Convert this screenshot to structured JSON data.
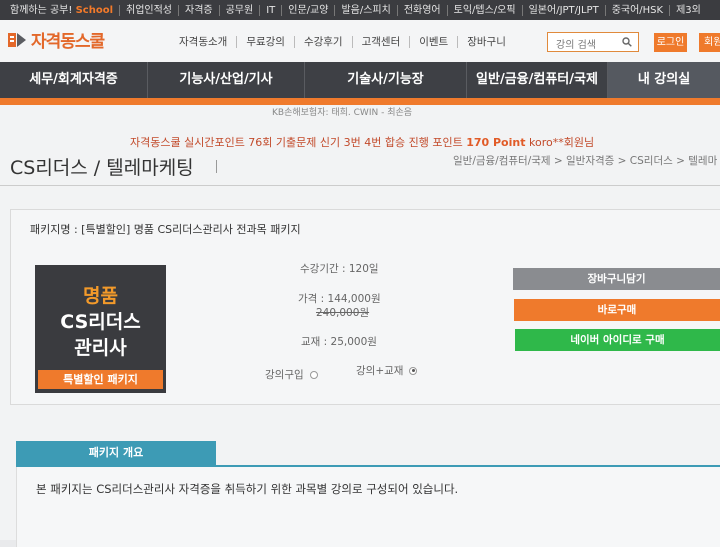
{
  "topbar": {
    "items": [
      "함께하는 공부!",
      "취업인적성",
      "자격증",
      "공무원",
      "IT",
      "인문/교양",
      "발음/스피치",
      "전화영어",
      "토익/텝스/오픽",
      "일본어/JPT/JLPT",
      "중국어/HSK",
      "제3외"
    ],
    "brand": "School"
  },
  "header": {
    "logo_text": "자격동스쿨",
    "nav": [
      "자격동소개",
      "무료강의",
      "수강후기",
      "고객센터",
      "이벤트",
      "장바구니"
    ],
    "search_placeholder": "강의 검색",
    "login_label": "로그인",
    "join_label": "회원"
  },
  "mainnav": {
    "items": [
      "세무/회계자격증",
      "기능사/산업/기사",
      "기술사/기능장",
      "일반/금융/컴퓨터/국제",
      "내 강의실"
    ]
  },
  "notice": {
    "line1": "KB손해보험자: 태희. CWIN - 최손음",
    "line2_prefix": "자격동스쿨 실시간포인트 76회 기출문제 신기 3번 4번 합승 진행 포인트 ",
    "line2_points": "170 Point",
    "line2_suffix": " koro**회원님"
  },
  "page": {
    "title": "CS리더스 / 텔레마케팅",
    "breadcrumb": "일반/금융/컴퓨터/국제 > 일반자격증 > CS리더스 > 텔레마"
  },
  "package": {
    "name": "패키지명 : [특별할인] 명품 CS리더스관리사 전과목 패키지",
    "book_line1": "명품",
    "book_line2": "CS리더스",
    "book_line3": "관리사",
    "book_ribbon": "특별할인 패키지",
    "period": "수강기간 : 120일",
    "price": "가격 : 144,000원",
    "original_price": "240,000원",
    "textbook": "교재 : 25,000원",
    "option_lecture": "강의구입",
    "option_lecture_textbook": "강의+교재",
    "selected_option": "강의+교재"
  },
  "buttons": {
    "cart": "장바구니담기",
    "buy": "바로구매",
    "naver": "네이버 아이디로 구매"
  },
  "overview": {
    "tab": "패키지 개요",
    "text": "본 패키지는 CS리더스관리사 자격증을 취득하기 위한 과목별 강의로 구성되어 있습니다."
  },
  "colors": {
    "accent_orange": "#ef7a2c",
    "nav_dark": "#3e4045",
    "naver_green": "#2fb84a",
    "overview_blue": "#3d9bb5"
  }
}
